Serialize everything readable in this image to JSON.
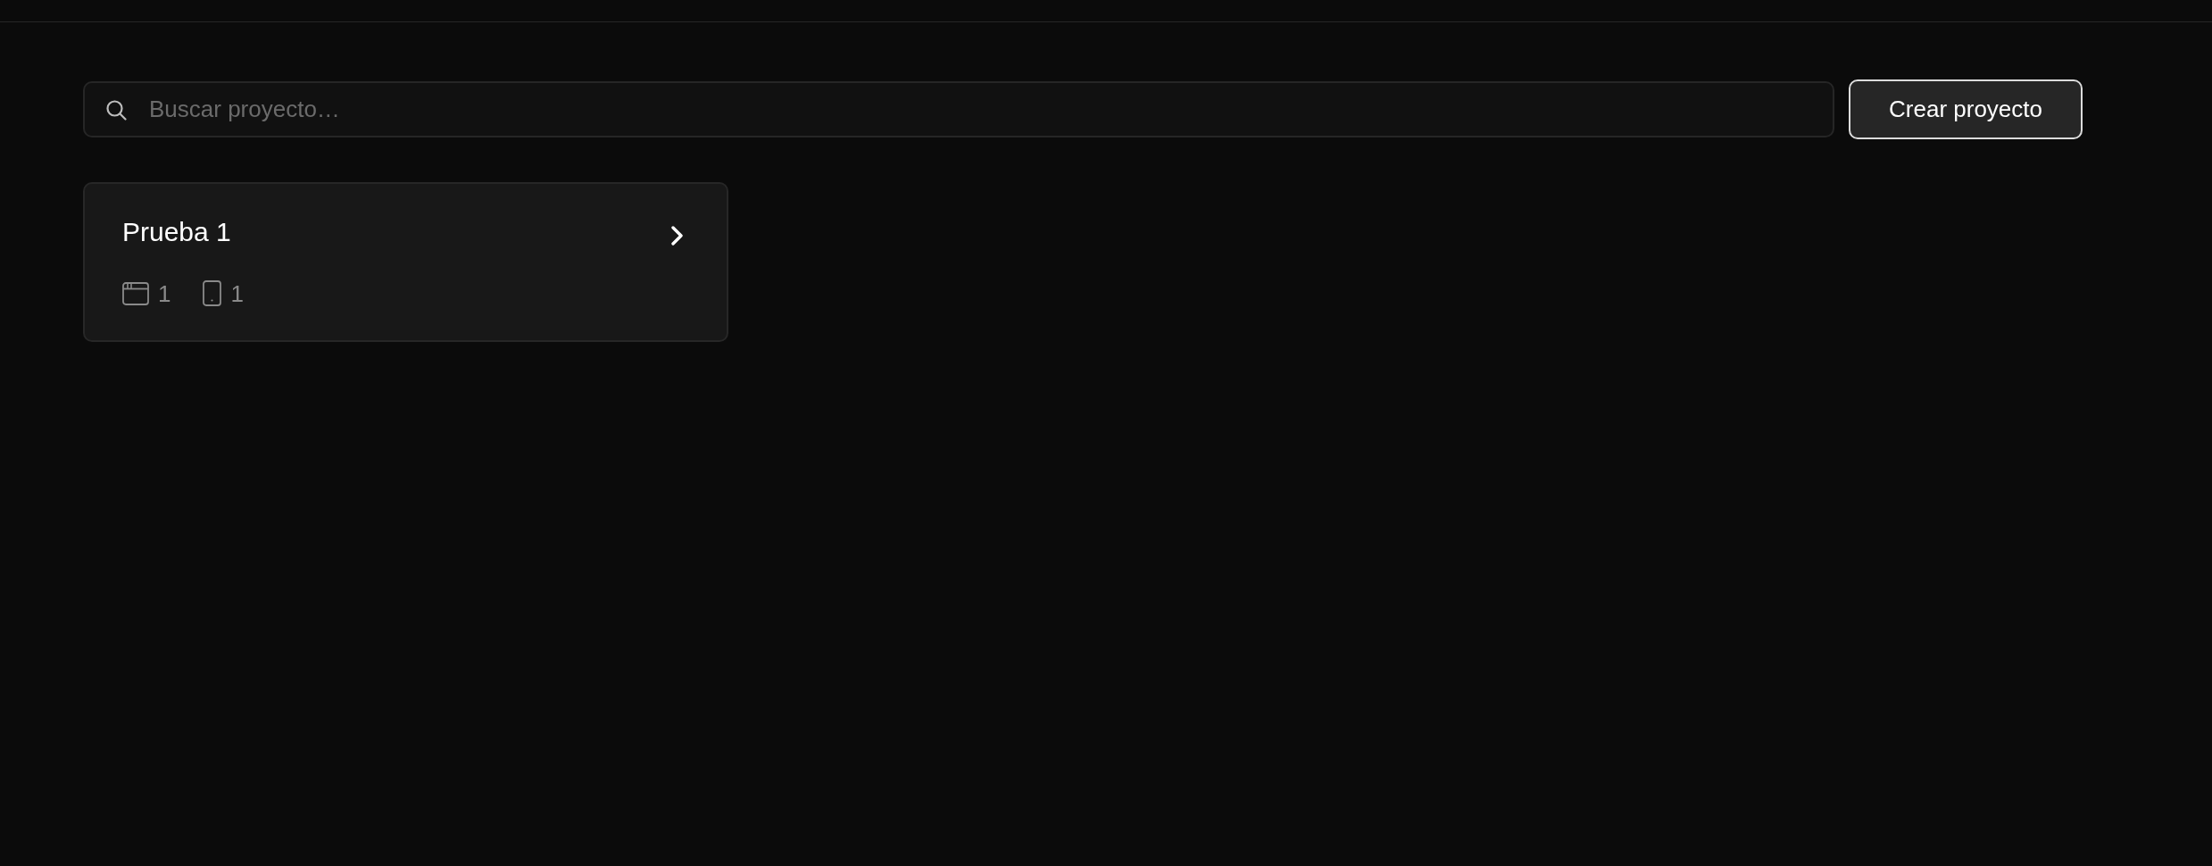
{
  "search": {
    "placeholder": "Buscar proyecto…"
  },
  "create_button": {
    "label": "Crear proyecto"
  },
  "projects": [
    {
      "name": "Prueba 1",
      "stats": [
        {
          "kind": "window",
          "count": "1"
        },
        {
          "kind": "device",
          "count": "1"
        }
      ]
    }
  ]
}
